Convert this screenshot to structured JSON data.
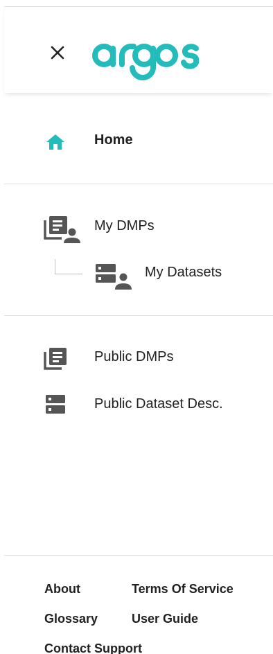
{
  "header": {
    "close_icon": "close-icon",
    "logo_text": "argos",
    "brand_color": "#23bcba"
  },
  "nav": {
    "home": {
      "label": "Home",
      "icon": "home-icon",
      "active": true
    },
    "my_dmps": {
      "label": "My DMPs",
      "icon": "documents-user-icon"
    },
    "my_datasets": {
      "label": "My Datasets",
      "icon": "dataset-user-icon"
    },
    "public_dmps": {
      "label": "Public DMPs",
      "icon": "documents-icon"
    },
    "public_datasets": {
      "label": "Public Dataset Desc.",
      "icon": "dataset-icon"
    }
  },
  "footer": {
    "about": "About",
    "terms": "Terms Of Service",
    "glossary": "Glossary",
    "user_guide": "User Guide",
    "contact": "Contact Support"
  },
  "colors": {
    "accent": "#23bcba",
    "icon": "#555555",
    "divider": "#e0e0e0"
  }
}
